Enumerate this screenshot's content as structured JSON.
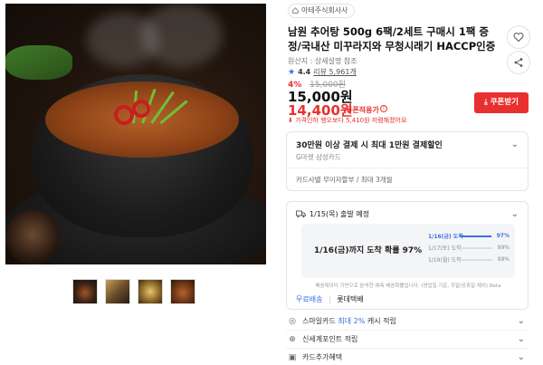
{
  "seller": {
    "name": "아테주식회사사",
    "icon": "home-icon"
  },
  "product": {
    "title": "남원 추어탕 500g 6팩/2세트 구매시 1팩 증정/국내산 미꾸라지와 무청시래기 HACCP인증",
    "origin_text": "원산지 : 상세설명 참조",
    "rating": "4.4",
    "review_text": "리뷰 5,961개",
    "discount_pct": "4%",
    "original_price": "15,000원",
    "price": "15,000원",
    "coupon_price": "14,400원",
    "coupon_price_label": "쿠폰적용가",
    "coupon_info": "i",
    "promo_note": "가격인하 행오보다 5,410원 저렴해졌어요"
  },
  "buttons": {
    "coupon": "쿠폰받기"
  },
  "payment_card": {
    "title": "30만원 이상 결제 시 최대 1만원 결제할인",
    "subtitle": "G마켓 삼성카드",
    "installment": "카드사별 무이자할부 / 최대 3개월"
  },
  "shipping": {
    "header": "1/15(목) 출발 예정",
    "headline": "1/16(금)까지 도착 확률 97%",
    "rows": [
      {
        "date": "1/16(금) 도착",
        "pct": "97%",
        "value": 0.97,
        "highlight": true
      },
      {
        "date": "1/17(토) 도착",
        "pct": "99%",
        "value": 0.99,
        "highlight": false
      },
      {
        "date": "1/19(월) 도착",
        "pct": "99%",
        "value": 0.99,
        "highlight": false
      }
    ],
    "footnote": "배송데이터 기반으로 분석한 예측 배송확률입니다. (영업일 기준, 주말/공휴일 제외) Beta",
    "free_label": "무료배송",
    "carrier": "롯데택배"
  },
  "list_items": [
    {
      "text": "스마일카드 최대 2% 캐시 적립",
      "pre": "스마일카드 ",
      "hl": "최대 2%",
      "post": " 캐시 적립",
      "icon": "coin-icon"
    },
    {
      "text": "신세계포인트 적립",
      "pre": "신세계포인트 적립",
      "hl": "",
      "post": "",
      "icon": "point-icon"
    },
    {
      "text": "카드추가혜택",
      "pre": "카드추가혜택",
      "hl": "",
      "post": "",
      "icon": "card-icon"
    }
  ],
  "colors": {
    "accent_red": "#e8312f",
    "accent_blue": "#3d6fe0"
  }
}
